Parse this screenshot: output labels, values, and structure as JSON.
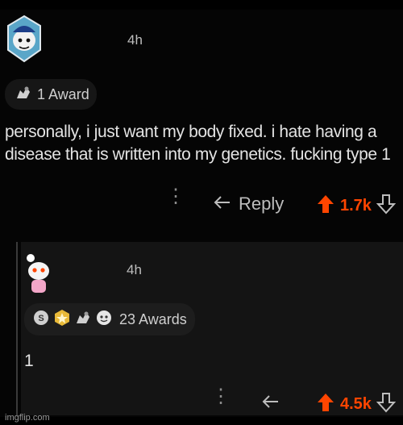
{
  "parent": {
    "time": "4h",
    "award_count_label": "1 Award",
    "body": "personally, i just want my body fixed. i hate having a disease that is written into my genetics. fucking type 1",
    "reply_label": "Reply",
    "score": "1.7k"
  },
  "reply": {
    "time": "4h",
    "award_count_label": "23 Awards",
    "body": "1",
    "score": "4.5k"
  },
  "watermark": "imgflip.com",
  "colors": {
    "upvote": "#ff4500",
    "background": "#050505",
    "reply_bg": "#141414"
  }
}
